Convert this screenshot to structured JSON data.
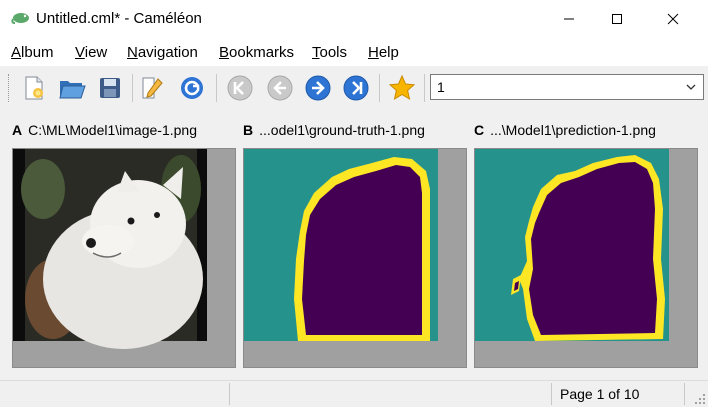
{
  "window": {
    "title": "Untitled.cml* - Caméléon"
  },
  "menu": [
    {
      "accel": "A",
      "rest": "lbum"
    },
    {
      "accel": "V",
      "rest": "iew"
    },
    {
      "accel": "N",
      "rest": "avigation"
    },
    {
      "accel": "B",
      "rest": "ookmarks"
    },
    {
      "accel": "T",
      "rest": "ools"
    },
    {
      "accel": "H",
      "rest": "elp"
    }
  ],
  "toolbar": {
    "icons": [
      "new-document-icon",
      "open-folder-icon",
      "save-icon",
      "edit-icon",
      "refresh-icon",
      "first-icon",
      "previous-icon",
      "next-icon",
      "last-icon",
      "bookmark-star-icon"
    ],
    "combo_value": "1"
  },
  "panels": [
    {
      "letter": "A",
      "path": "C:\\ML\\Model1\\image-1.png"
    },
    {
      "letter": "B",
      "path": "...odel1\\ground-truth-1.png"
    },
    {
      "letter": "C",
      "path": "...\\Model1\\prediction-1.png"
    }
  ],
  "colors": {
    "seg_background": "#26928c",
    "seg_region": "#440154",
    "seg_border": "#fde725"
  },
  "status": {
    "page": "Page 1 of 10"
  }
}
